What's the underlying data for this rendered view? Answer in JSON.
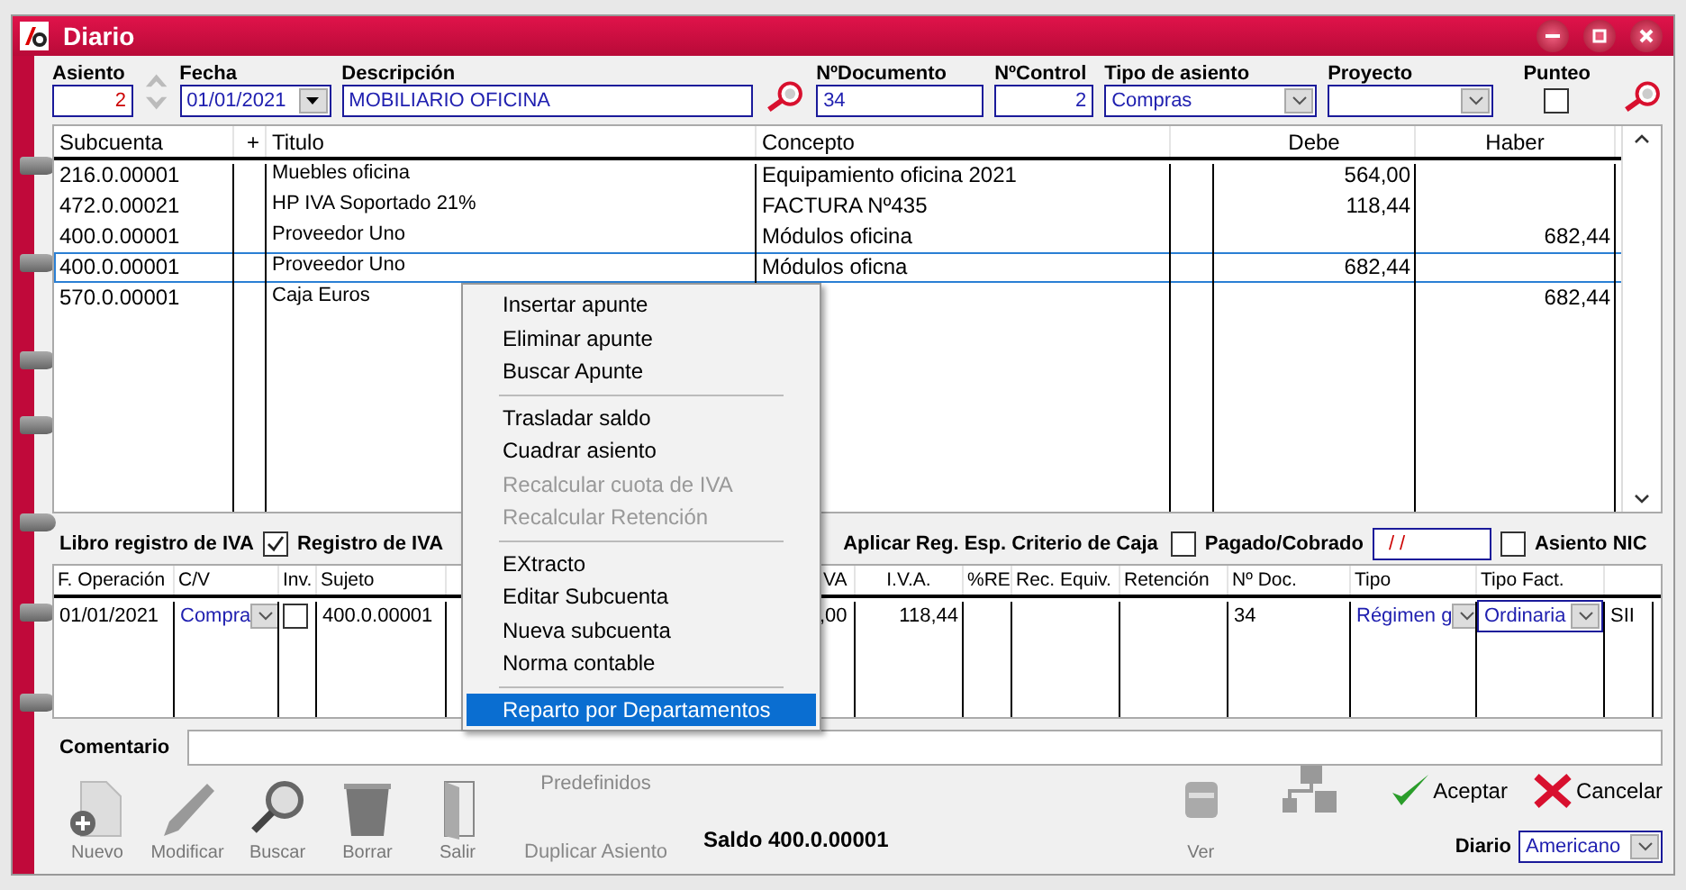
{
  "window": {
    "title": "Diario"
  },
  "header": {
    "asiento": {
      "label": "Asiento",
      "value": "2"
    },
    "fecha": {
      "label": "Fecha",
      "value": "01/01/2021"
    },
    "descripcion": {
      "label": "Descripción",
      "value": "MOBILIARIO OFICINA"
    },
    "documento": {
      "label": "NºDocumento",
      "value": "34"
    },
    "control": {
      "label": "NºControl",
      "value": "2"
    },
    "tipo_asiento": {
      "label": "Tipo de asiento",
      "value": "Compras"
    },
    "proyecto": {
      "label": "Proyecto"
    },
    "punteo": {
      "label": "Punteo",
      "checked": false
    }
  },
  "entries": {
    "columns": [
      "Subcuenta",
      "+",
      "Titulo",
      "Concepto",
      "Debe",
      "Haber"
    ],
    "rows": [
      {
        "subcuenta": "216.0.00001",
        "titulo": "Muebles oficina",
        "concepto": "Equipamiento oficina 2021",
        "debe": "564,00",
        "selected": false
      },
      {
        "subcuenta": "472.0.00021",
        "titulo": "HP IVA Soportado 21%",
        "concepto": "FACTURA Nº435",
        "debe": "118,44",
        "selected": false
      },
      {
        "subcuenta": "400.0.00001",
        "titulo": "Proveedor Uno",
        "concepto": "Módulos oficina",
        "haber": "682,44",
        "selected": false
      },
      {
        "subcuenta": "400.0.00001",
        "titulo": "Proveedor Uno",
        "concepto": "Módulos oficna",
        "debe": "682,44",
        "selected": true
      },
      {
        "subcuenta": "570.0.00001",
        "titulo": "Caja Euros",
        "haber": "682,44",
        "selected": false
      }
    ]
  },
  "iva_bar": {
    "title": "Libro registro de IVA",
    "registro": {
      "label": "Registro de IVA",
      "checked": true
    },
    "criterio": "Aplicar Reg. Esp. Criterio de Caja",
    "pagado": {
      "label": "Pagado/Cobrado",
      "checked": false
    },
    "pagado_date": "/ /",
    "nic": {
      "label": "Asiento NIC",
      "checked": false
    }
  },
  "iva_grid": {
    "columns": [
      "F. Operación",
      "C/V",
      "Inv.",
      "Sujeto",
      "VA",
      "I.V.A.",
      "%RE",
      "Rec. Equiv.",
      "Retención",
      "Nº Doc.",
      "Tipo",
      "Tipo Fact."
    ],
    "rows": [
      {
        "fecha": "01/01/2021",
        "cv": "Compra",
        "inv": false,
        "sujeto": "400.0.00001",
        "va": ",00",
        "iva": "118,44",
        "doc": "34",
        "tipo": "Régimen g",
        "tipo_fact": "Ordinaria",
        "extra": "SII"
      }
    ]
  },
  "comentario": {
    "label": "Comentario"
  },
  "context_menu": [
    {
      "kind": "item",
      "label": "Insertar apunte",
      "disabled": false,
      "selected": false
    },
    {
      "kind": "item",
      "label": "Eliminar apunte",
      "disabled": false,
      "selected": false
    },
    {
      "kind": "item",
      "label": "Buscar Apunte",
      "disabled": false,
      "selected": false
    },
    {
      "kind": "separator"
    },
    {
      "kind": "item",
      "label": "Trasladar saldo",
      "disabled": false,
      "selected": false
    },
    {
      "kind": "item",
      "label": "Cuadrar asiento",
      "disabled": false,
      "selected": false
    },
    {
      "kind": "item",
      "label": "Recalcular cuota de IVA",
      "disabled": true,
      "selected": false
    },
    {
      "kind": "item",
      "label": "Recalcular Retención",
      "disabled": true,
      "selected": false
    },
    {
      "kind": "separator"
    },
    {
      "kind": "item",
      "label": "EXtracto",
      "disabled": false,
      "selected": false
    },
    {
      "kind": "item",
      "label": "Editar Subcuenta",
      "disabled": false,
      "selected": false
    },
    {
      "kind": "item",
      "label": "Nueva subcuenta",
      "disabled": false,
      "selected": false
    },
    {
      "kind": "item",
      "label": "Norma contable",
      "disabled": false,
      "selected": false
    },
    {
      "kind": "separator"
    },
    {
      "kind": "item",
      "label": "Reparto por Departamentos",
      "disabled": false,
      "selected": true
    }
  ],
  "toolbar": {
    "tools": [
      {
        "kind": "new",
        "label": "Nuevo"
      },
      {
        "kind": "edit",
        "label": "Modificar"
      },
      {
        "kind": "search",
        "label": "Buscar"
      },
      {
        "kind": "delete",
        "label": "Borrar"
      },
      {
        "kind": "exit",
        "label": "Salir"
      }
    ],
    "predefinidos": "Predefinidos",
    "duplicar": "Duplicar Asiento",
    "saldo": "Saldo 400.0.00001",
    "ver": "Ver",
    "aceptar": "Aceptar",
    "cancelar": "Cancelar",
    "diario": {
      "label": "Diario",
      "value": "Americano"
    }
  }
}
